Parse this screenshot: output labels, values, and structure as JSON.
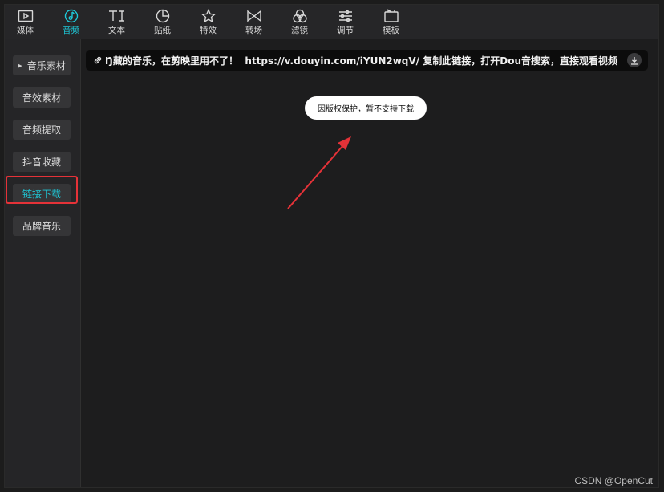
{
  "toolbar": {
    "tabs": [
      {
        "label": "媒体",
        "icon": "media-icon"
      },
      {
        "label": "音频",
        "icon": "audio-icon",
        "active": true
      },
      {
        "label": "文本",
        "icon": "text-icon"
      },
      {
        "label": "贴纸",
        "icon": "sticker-icon"
      },
      {
        "label": "特效",
        "icon": "effects-icon"
      },
      {
        "label": "转场",
        "icon": "transition-icon"
      },
      {
        "label": "滤镜",
        "icon": "filter-icon"
      },
      {
        "label": "调节",
        "icon": "adjust-icon"
      },
      {
        "label": "模板",
        "icon": "template-icon"
      }
    ]
  },
  "sidebar": {
    "items": [
      {
        "label": "音乐素材",
        "expandable": true
      },
      {
        "label": "音效素材"
      },
      {
        "label": "音频提取"
      },
      {
        "label": "抖音收藏"
      },
      {
        "label": "链接下载",
        "active": true
      },
      {
        "label": "品牌音乐"
      }
    ]
  },
  "link_input": {
    "value": "Ŋ藏的音乐，在剪映里用不了！  https://v.douyin.com/iYUN2wqV/ 复制此链接，打开Dou音搜索，直接观看视频！"
  },
  "tooltip": {
    "text": "因版权保护，暂不支持下载"
  },
  "watermark": {
    "text": "CSDN @OpenCut"
  },
  "colors": {
    "accent": "#1ec8d8",
    "annotation": "#e53238"
  }
}
